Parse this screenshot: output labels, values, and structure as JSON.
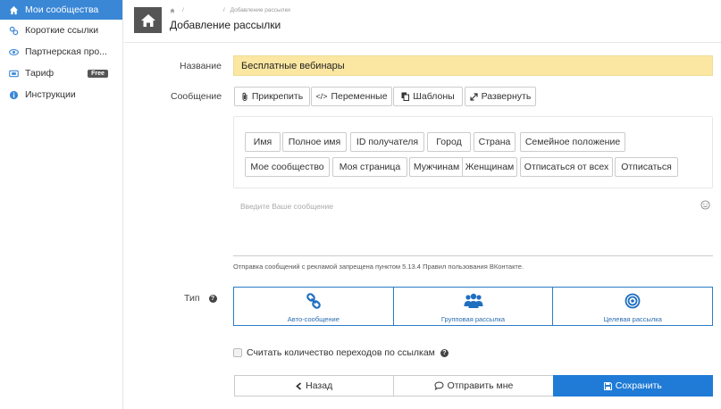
{
  "sidebar": {
    "items": [
      {
        "label": "Мои сообщества",
        "icon": "home-icon"
      },
      {
        "label": "Короткие ссылки",
        "icon": "link-icon"
      },
      {
        "label": "Партнерская про...",
        "icon": "eye-icon"
      },
      {
        "label": "Тариф",
        "icon": "card-icon",
        "badge": "Free"
      },
      {
        "label": "Инструкции",
        "icon": "info-icon"
      }
    ],
    "active_color": "#3a87d6"
  },
  "header": {
    "breadcrumb": [
      "",
      "Добавление рассылки"
    ],
    "title": "Добавление рассылки"
  },
  "form": {
    "name_label": "Название",
    "name_value": "Бесплатные вебинары",
    "message_label": "Сообщение",
    "toolbar": {
      "attach": "Прикрепить",
      "variables": "Переменные",
      "templates": "Шаблоны",
      "expand": "Развернуть"
    },
    "variables": [
      "Имя",
      "Полное имя",
      "ID получателя",
      "Город",
      "Страна",
      "Семейное положение",
      "Мое сообщество",
      "Моя страница",
      "Мужчинам",
      "Женщинам",
      "Отписаться от всех",
      "Отписаться"
    ],
    "message_placeholder": "Введите Ваше сообщение",
    "warning": "Отправка сообщений с рекламой запрещена пунктом 5.13.4 Правил пользования ВКонтакте.",
    "type_label": "Тип",
    "types": [
      "Авто-сообщение",
      "Групповая рассылка",
      "Целевая рассылка"
    ],
    "count_clicks_label": "Считать количество переходов по ссылкам",
    "count_clicks_checked": false
  },
  "actions": {
    "back": "Назад",
    "send_me": "Отправить мне",
    "save": "Сохранить"
  },
  "colors": {
    "primary": "#1f7bd6",
    "name_bg": "#fbe7a1",
    "type_border": "#2a7cc7"
  }
}
